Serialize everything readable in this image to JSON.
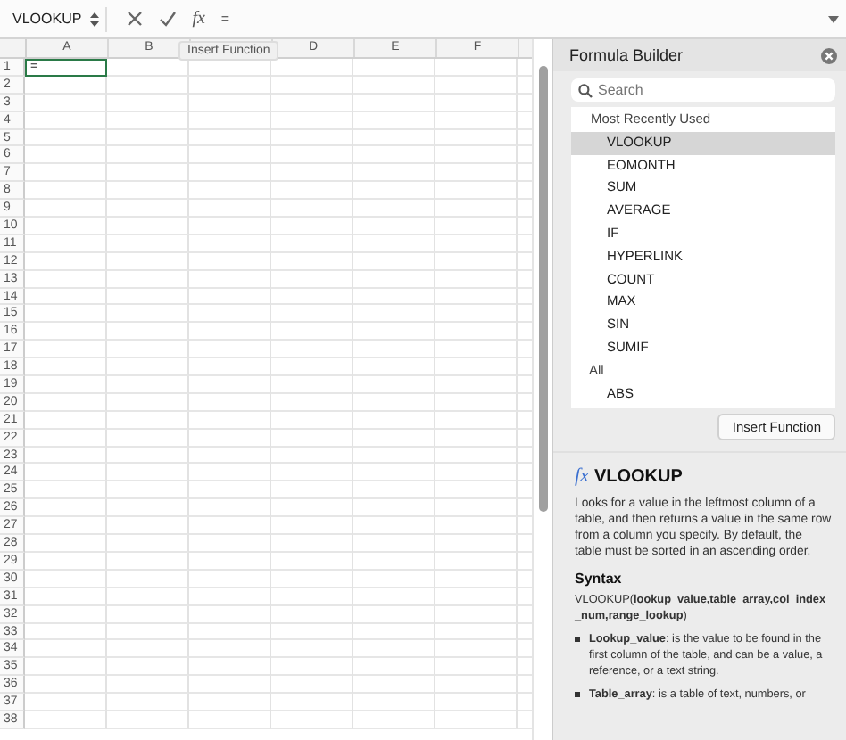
{
  "formula_bar": {
    "name_box": "VLOOKUP",
    "fx": "fx",
    "formula": "=",
    "tooltip": "Insert Function"
  },
  "sheet": {
    "columns": [
      {
        "label": "A"
      },
      {
        "label": "B"
      },
      {},
      {
        "label": "D"
      },
      {
        "label": "E"
      },
      {
        "label": "F"
      }
    ],
    "rows": [
      {
        "label": "1",
        "cells": [
          {
            "value": "=",
            "selected": true
          }
        ]
      },
      {
        "label": "2"
      },
      {
        "label": "3"
      },
      {
        "label": "4"
      },
      {
        "label": "5"
      },
      {
        "label": "6"
      },
      {
        "label": "7"
      },
      {
        "label": "8"
      },
      {
        "label": "9"
      },
      {
        "label": "10"
      },
      {
        "label": "11"
      },
      {
        "label": "12"
      },
      {
        "label": "13"
      },
      {
        "label": "14"
      },
      {
        "label": "15"
      },
      {
        "label": "16"
      },
      {
        "label": "17"
      },
      {
        "label": "18"
      },
      {
        "label": "19"
      },
      {
        "label": "20"
      },
      {
        "label": "21"
      },
      {
        "label": "22"
      },
      {
        "label": "23"
      },
      {
        "label": "24"
      },
      {
        "label": "25"
      },
      {
        "label": "26"
      },
      {
        "label": "27"
      },
      {
        "label": "28"
      },
      {
        "label": "29"
      },
      {
        "label": "30"
      },
      {
        "label": "31"
      },
      {
        "label": "32"
      },
      {
        "label": "33"
      },
      {
        "label": "34"
      },
      {
        "label": "35"
      },
      {
        "label": "36"
      },
      {
        "label": "37"
      },
      {
        "label": "38"
      }
    ]
  },
  "panel": {
    "title": "Formula Builder",
    "search": {
      "placeholder": "Search"
    },
    "groups": [
      {
        "label": "Most Recently Used",
        "children": [
          {
            "label": "VLOOKUP",
            "selected": true
          },
          {
            "label": "EOMONTH",
            "selected": false
          },
          {
            "label": "SUM",
            "selected": false
          },
          {
            "label": "AVERAGE",
            "selected": false
          },
          {
            "label": "IF",
            "selected": false
          },
          {
            "label": "HYPERLINK",
            "selected": false
          },
          {
            "label": "COUNT",
            "selected": false
          },
          {
            "label": "MAX",
            "selected": false
          },
          {
            "label": "SIN",
            "selected": false
          },
          {
            "label": "SUMIF",
            "selected": false
          }
        ]
      },
      {
        "label": "All",
        "children": [
          {
            "label": "ABS",
            "selected": false
          }
        ]
      }
    ],
    "insert_button": "Insert Function",
    "detail": {
      "fx": "fx",
      "name": "VLOOKUP",
      "description": "Looks for a value in the leftmost column of a table, and then returns a value in the same row from a column you specify. By default, the table must be sorted in an ascending order.",
      "syntax_heading": "Syntax",
      "syntax": "VLOOKUP(**lookup_value,table_array,col_index_num,range_lookup**)",
      "arguments": [
        "**Lookup_value**: is the value to be found in the first column of the table, and can be a value, a reference, or a text string.",
        "**Table_array**: is a table of text, numbers, or"
      ]
    }
  }
}
